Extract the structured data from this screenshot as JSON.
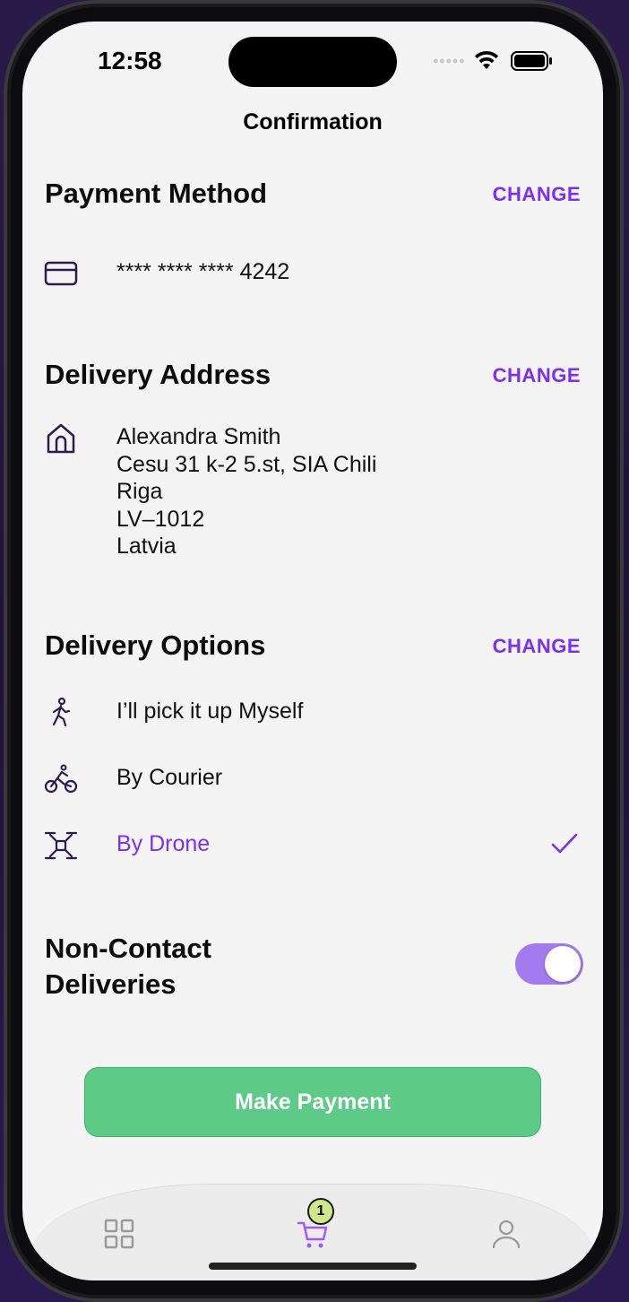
{
  "status_bar": {
    "time": "12:58"
  },
  "nav": {
    "title": "Confirmation"
  },
  "payment": {
    "title": "Payment Method",
    "change_label": "CHANGE",
    "card_number": "**** **** **** 4242"
  },
  "address": {
    "title": "Delivery Address",
    "change_label": "CHANGE",
    "lines": [
      "Alexandra Smith",
      "Cesu 31 k-2 5.st, SIA Chili",
      "Riga",
      "LV–1012",
      "Latvia"
    ]
  },
  "delivery_options": {
    "title": "Delivery Options",
    "change_label": "CHANGE",
    "items": [
      {
        "label": "I’ll pick it up Myself",
        "icon": "walking-person-icon",
        "selected": false
      },
      {
        "label": "By Courier",
        "icon": "bicycle-icon",
        "selected": false
      },
      {
        "label": "By Drone",
        "icon": "drone-icon",
        "selected": true
      }
    ]
  },
  "non_contact": {
    "title_line1": "Non-Contact",
    "title_line2": "Deliveries",
    "enabled": true
  },
  "pay_button": {
    "label": "Make Payment"
  },
  "tab_bar": {
    "items": [
      {
        "name": "catalog",
        "icon": "grid-icon"
      },
      {
        "name": "cart",
        "icon": "cart-icon",
        "badge": "1"
      },
      {
        "name": "profile",
        "icon": "user-icon"
      }
    ]
  },
  "colors": {
    "accent": "#7b2ff2",
    "pay_button": "#5dcb87",
    "toggle_on": "#a37bef",
    "badge": "#cfe98a"
  }
}
